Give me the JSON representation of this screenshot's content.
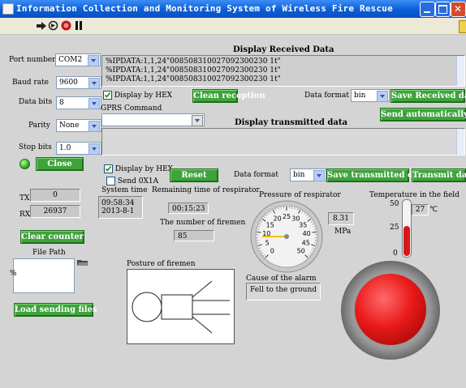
{
  "window": {
    "title": "Information Collection and Monitoring System of Wireless Fire Rescue"
  },
  "port": {
    "port_label": "Port number",
    "port_value": "COM2",
    "baud_label": "Baud rate",
    "baud_value": "9600",
    "bits_label": "Data bits",
    "bits_value": "8",
    "parity_label": "Parity",
    "parity_value": "None",
    "stop_label": "Stop bits",
    "stop_value": "1.0",
    "close_label": "Close"
  },
  "received": {
    "title": "Display Received Data",
    "lines": [
      "%IPDATA:1,1,24\"008508310027092300230 1t\"",
      "%IPDATA:1,1,24\"008508310027092300230 1t\"",
      "%IPDATA:1,1,24\"008508310027092300230 1t\""
    ],
    "hex_label": "Display by HEX",
    "clean_label": "Clean reception",
    "format_label": "Data format",
    "format_value": "bin",
    "save_label": "Save Received data"
  },
  "transmit": {
    "gprs_label": "GPRS Command",
    "title": "Display transmitted data",
    "send_auto_label": "Send automatically",
    "hex_label": "Display by HEX",
    "send0x1a_label": "Send 0X1A",
    "reset_label": "Reset",
    "format_label": "Data format",
    "format_value": "bin",
    "save_label": "Save transmitted data",
    "transmit_label": "Transmit data"
  },
  "counters": {
    "tx_label": "TX",
    "tx_value": "0",
    "rx_label": "RX",
    "rx_value": "26937",
    "clear_label": "Clear counter"
  },
  "file": {
    "path_label": "File Path",
    "path_value": "%",
    "load_label": "Load sending files"
  },
  "status": {
    "systime_label": "System time",
    "systime_value": "09:58:34\n2013-8-1",
    "remain_label": "Remaining time of respirator",
    "remain_value": "00:15:23",
    "firemen_label": "The number of firemen",
    "firemen_value": "85",
    "posture_label": "Posture of firemen",
    "pressure_label": "Pressure of respirator",
    "pressure_value": "8.31",
    "pressure_unit": "MPa",
    "temp_label": "Temperature in the field",
    "temp_value": "27",
    "temp_unit": "℃",
    "cause_label": "Cause of the alarm",
    "cause_value": "Fell to the ground"
  },
  "gauge": {
    "min": 0,
    "max": 50,
    "value": 8.31,
    "ticks": [
      "0",
      "5",
      "10",
      "15",
      "20",
      "25",
      "30",
      "35",
      "40",
      "45",
      "50"
    ]
  },
  "thermo": {
    "min": 0,
    "max": 50,
    "value": 27,
    "ticks": [
      "50",
      "25",
      "0"
    ]
  },
  "colors": {
    "button_green": "#3ea33b",
    "alarm_red": "#e21a1a",
    "thermo_red": "#d81818"
  }
}
